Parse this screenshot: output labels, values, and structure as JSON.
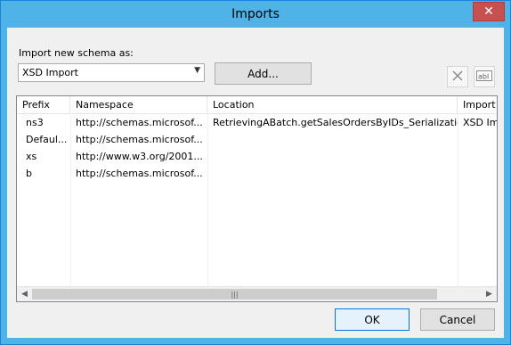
{
  "window": {
    "title": "Imports",
    "close_glyph": "✕"
  },
  "import_label": "Import new schema as:",
  "import_select": {
    "value": "XSD Import",
    "options": [
      "XSD Import"
    ]
  },
  "buttons": {
    "add": "Add...",
    "ok": "OK",
    "cancel": "Cancel"
  },
  "toolbar_icons": [
    "delete-icon",
    "rename-icon"
  ],
  "grid": {
    "columns": [
      "Prefix",
      "Namespace",
      "Location",
      "Import"
    ],
    "rows": [
      [
        "ns3",
        "http://schemas.microsof...",
        "RetrievingABatch.getSalesOrdersByIDs_Serialization",
        "XSD Im"
      ],
      [
        "Defaul...",
        "http://schemas.microsof...",
        "",
        ""
      ],
      [
        "xs",
        "http://www.w3.org/2001...",
        "",
        ""
      ],
      [
        "b",
        "http://schemas.microsof...",
        "",
        ""
      ]
    ]
  },
  "scrollbar": {
    "thumb_grip": "|||"
  }
}
